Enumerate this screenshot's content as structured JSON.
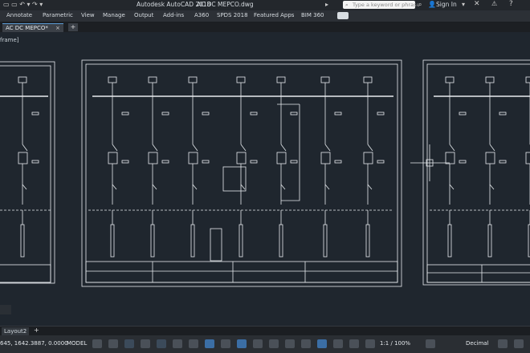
{
  "app": {
    "title": "Autodesk AutoCAD 2018",
    "document": "AC DC MEPCO.dwg",
    "search_placeholder": "Type a keyword or phrase",
    "sign_in": "Sign In"
  },
  "ribbon": {
    "tabs": [
      "Annotate",
      "Parametric",
      "View",
      "Manage",
      "Output",
      "Add-ins",
      "A360",
      "SPDS 2018",
      "Featured Apps",
      "BIM 360"
    ]
  },
  "doc_tabs": {
    "active": "AC DC MEPCO*",
    "add_label": "+"
  },
  "viewport": {
    "label": "frame]"
  },
  "layout_tabs": {
    "current": "Layout2",
    "add_label": "+"
  },
  "status": {
    "coordinates": "645, 1642.3887, 0.0000",
    "space": "MODEL",
    "scale": "1:1 / 100%",
    "units": "Decimal"
  },
  "colors": {
    "canvas": "#1f262e",
    "line": "#e8ecef",
    "accent": "#5b9bd5"
  }
}
